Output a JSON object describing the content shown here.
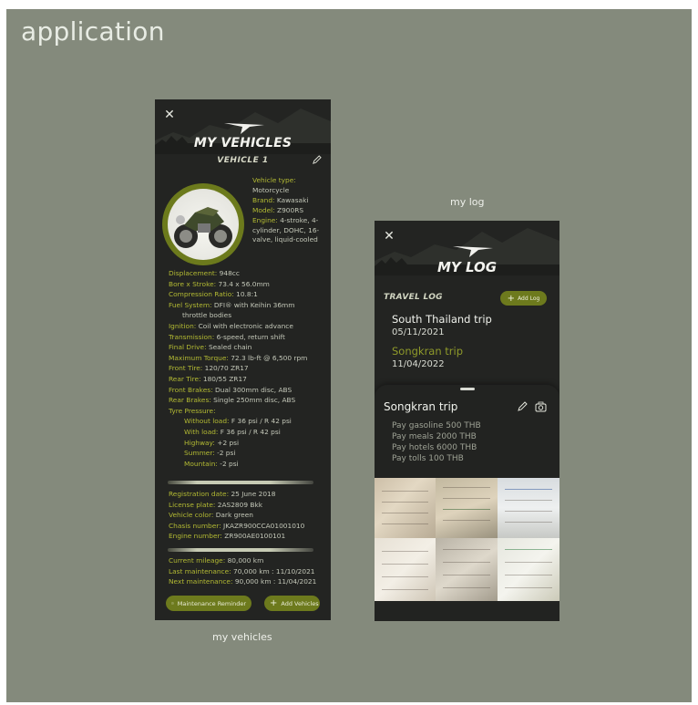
{
  "page": {
    "title": "application"
  },
  "captions": {
    "vehicles": "my vehicles",
    "log": "my log"
  },
  "vehicles": {
    "header": "MY VEHICLES",
    "subtitle": "VEHICLE 1",
    "side_specs": [
      {
        "k": "Vehicle type:",
        "v": "Motorcycle"
      },
      {
        "k": "Brand:",
        "v": "Kawasaki"
      },
      {
        "k": "Model:",
        "v": "Z900RS"
      },
      {
        "k": "Engine:",
        "v": "4-stroke, 4-cylinder, DOHC, 16-valve, liquid-cooled"
      }
    ],
    "specs": [
      {
        "k": "Displacement:",
        "v": "948cc"
      },
      {
        "k": "Bore x Stroke:",
        "v": "73.4 x 56.0mm"
      },
      {
        "k": "Compression Ratio:",
        "v": "10.8:1"
      },
      {
        "k": "Fuel System:",
        "v": "DFI® with Keihin 36mm"
      },
      {
        "k": "",
        "v": "throttle bodies",
        "indent": true
      },
      {
        "k": "Ignition:",
        "v": "Coil with electronic advance"
      },
      {
        "k": "Transmission:",
        "v": "6-speed, return shift"
      },
      {
        "k": "Final Drive:",
        "v": "Sealed chain"
      },
      {
        "k": "Maximum Torque:",
        "v": "72.3 lb-ft @ 6,500 rpm"
      },
      {
        "k": "Front Tire:",
        "v": "120/70 ZR17"
      },
      {
        "k": "Rear Tire:",
        "v": "180/55 ZR17"
      },
      {
        "k": "Front Brakes:",
        "v": "Dual 300mm disc, ABS"
      },
      {
        "k": "Rear Brakes:",
        "v": "Single 250mm disc, ABS"
      },
      {
        "k": "Tyre Pressure:",
        "v": ""
      }
    ],
    "tyre": [
      {
        "k": "Without load:",
        "v": "F 36 psi / R 42 psi"
      },
      {
        "k": "With load:",
        "v": "F 36 psi / R 42 psi"
      },
      {
        "k": "Highway:",
        "v": "+2 psi"
      },
      {
        "k": "Summer:",
        "v": "-2 psi"
      },
      {
        "k": "Mountain:",
        "v": "-2 psi"
      }
    ],
    "registration": [
      {
        "k": "Registration date:",
        "v": "25 June 2018"
      },
      {
        "k": "License plate:",
        "v": "2AS2809 Bkk"
      },
      {
        "k": "Vehicle color:",
        "v": "Dark green"
      },
      {
        "k": "Chasis number:",
        "v": "JKAZR900CCA01001010"
      },
      {
        "k": "Engine number:",
        "v": "ZR900AE0100101"
      }
    ],
    "mileage": [
      {
        "k": "Current mileage:",
        "v": "80,000 km"
      },
      {
        "k": "Last maintenance:",
        "v": "70,000 km : 11/10/2021"
      },
      {
        "k": "Next maintenance:",
        "v": "90,000 km : 11/04/2021"
      }
    ],
    "buttons": {
      "maintenance": "Maintenance Reminder",
      "add": "Add Vehicles"
    }
  },
  "log": {
    "header": "MY LOG",
    "section": "TRAVEL LOG",
    "add_button": "Add Log",
    "trips": [
      {
        "name": "South Thailand trip",
        "date": "05/11/2021"
      },
      {
        "name": "Songkran trip",
        "date": "11/04/2022"
      }
    ],
    "detail": {
      "title": "Songkran trip",
      "expenses": [
        "Pay gasoline 500 THB",
        "Pay meals 2000 THB",
        "Pay hotels 6000 THB",
        "Pay tolls 100 THB"
      ]
    }
  },
  "colors": {
    "accent": "#6d7a1d",
    "accent_text": "#b3ba33",
    "panel": "#232422",
    "background": "#848a7c"
  }
}
